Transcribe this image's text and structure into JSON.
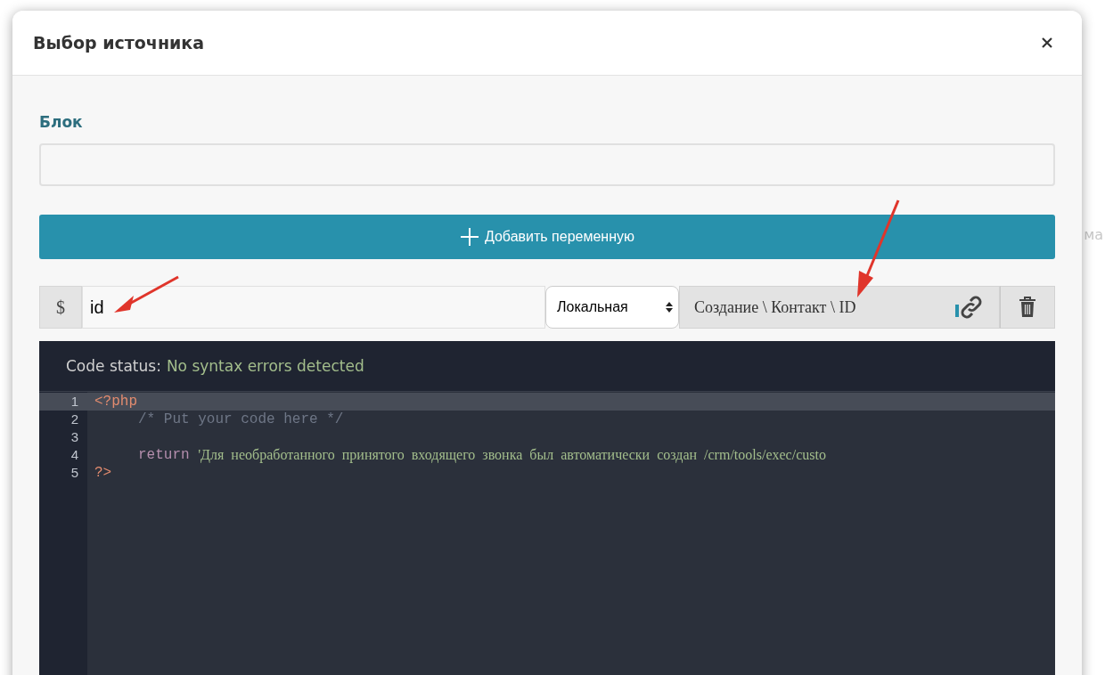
{
  "background_text": "ма",
  "dialog": {
    "title": "Выбор источника"
  },
  "block": {
    "label": "Блок"
  },
  "add_button": {
    "label": "Добавить переменную"
  },
  "variable": {
    "prefix": "$",
    "name": "id",
    "scope": "Локальная",
    "source": "Создание \\ Контакт \\ ID"
  },
  "editor": {
    "status_label": "Code status:",
    "status_text": "No syntax errors detected",
    "lines": [
      {
        "number": "1",
        "active": true,
        "tokens": [
          {
            "kind": "tag",
            "text": "<?php"
          }
        ]
      },
      {
        "number": "2",
        "active": false,
        "indented": true,
        "tokens": [
          {
            "kind": "comment",
            "text": "/* Put your code here */"
          }
        ]
      },
      {
        "number": "3",
        "active": false
      },
      {
        "number": "4",
        "active": false,
        "indented": true,
        "tokens": [
          {
            "kind": "keyword",
            "text": "return"
          },
          {
            "kind": "string",
            "text": "'Для необработанного принятого входящего звонка был автоматически создан /crm/tools/exec/custo"
          }
        ]
      },
      {
        "number": "5",
        "active": false,
        "tokens": [
          {
            "kind": "tag",
            "text": "?>"
          }
        ]
      }
    ]
  }
}
